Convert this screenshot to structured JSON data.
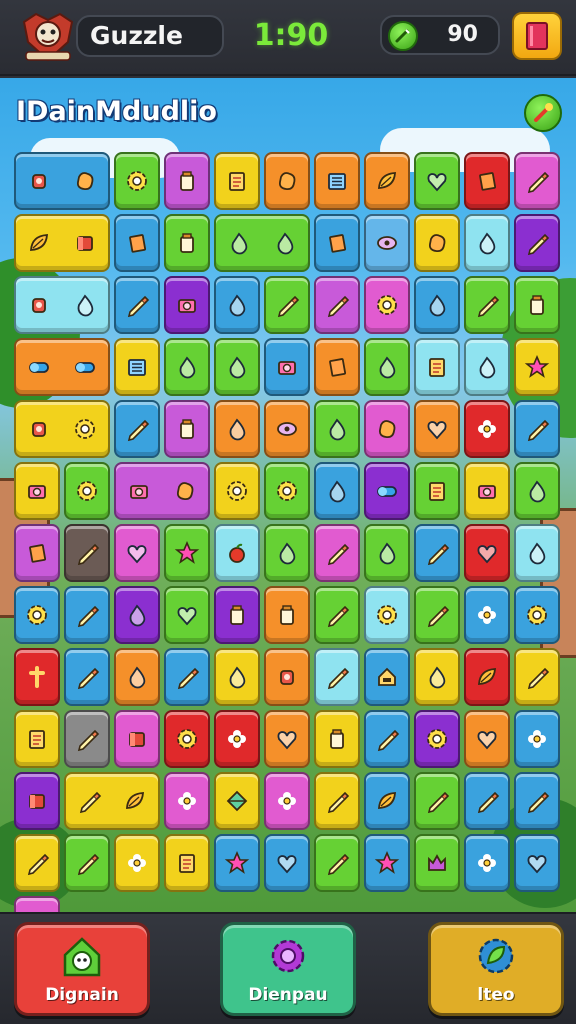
{
  "header": {
    "player_name": "Guzzle",
    "timer": "1:90",
    "coins": "90",
    "logo_icon": "mascot-crest-icon",
    "coin_icon": "green-coin-icon",
    "menu_icon": "book-icon"
  },
  "level": {
    "title": "IDainMdudlio",
    "hint_icon": "magic-hint-icon"
  },
  "board": {
    "rows": [
      [
        {
          "c": "#3aa2de",
          "g": "cup",
          "span": 2,
          "g2": "blob"
        },
        {
          "c": "#66d134",
          "g": "gear"
        },
        {
          "c": "#c85ad9",
          "g": "jar"
        },
        {
          "c": "#f2d21c",
          "g": "book"
        },
        {
          "c": "#f5902a",
          "g": "blob"
        },
        {
          "c": "#f5902a",
          "g": "list"
        },
        {
          "c": "#f5902a",
          "g": "leaf"
        },
        {
          "c": "#66d134",
          "g": "heart"
        },
        {
          "c": "#e0292b",
          "g": "tag"
        },
        {
          "c": "#e15bd0",
          "g": "pencil"
        }
      ],
      [
        {
          "c": "#f2d21c",
          "g": "leaf",
          "span": 2,
          "g2": "box"
        },
        {
          "c": "#3aa2de",
          "g": "tag"
        },
        {
          "c": "#66d134",
          "g": "jar"
        },
        {
          "c": "#66d134",
          "g": "drop",
          "span": 2,
          "g2": "drop"
        },
        {
          "c": "#3aa2de",
          "g": "tag"
        },
        {
          "c": "#64b6ea",
          "g": "eye"
        },
        {
          "c": "#f2d21c",
          "g": "blob"
        },
        {
          "c": "#8fe3f0",
          "g": "drop"
        },
        {
          "c": "#8b2fd0",
          "g": "pencil"
        }
      ],
      [
        {
          "c": "#8fe3f0",
          "g": "cup",
          "span": 2,
          "g2": "drop"
        },
        {
          "c": "#3aa2de",
          "g": "pencil"
        },
        {
          "c": "#8b2fd0",
          "g": "camera"
        },
        {
          "c": "#3aa2de",
          "g": "drop"
        },
        {
          "c": "#66d134",
          "g": "pencil"
        },
        {
          "c": "#c85ad9",
          "g": "pencil"
        },
        {
          "c": "#e15bd0",
          "g": "gear"
        },
        {
          "c": "#3aa2de",
          "g": "drop"
        },
        {
          "c": "#66d134",
          "g": "pencil"
        },
        {
          "c": "#66d134",
          "g": "jar"
        }
      ],
      [
        {
          "c": "#f5902a",
          "g": "pill",
          "span": 2,
          "g2": "pill"
        },
        {
          "c": "#f2d21c",
          "g": "list"
        },
        {
          "c": "#66d134",
          "g": "drop"
        },
        {
          "c": "#66d134",
          "g": "drop"
        },
        {
          "c": "#3aa2de",
          "g": "camera"
        },
        {
          "c": "#f5902a",
          "g": "tag"
        },
        {
          "c": "#66d134",
          "g": "drop"
        },
        {
          "c": "#8fe3f0",
          "g": "book"
        },
        {
          "c": "#8fe3f0",
          "g": "drop"
        },
        {
          "c": "#f2d21c",
          "g": "star"
        }
      ],
      [
        {
          "c": "#f2d21c",
          "g": "cup",
          "span": 2,
          "g2": "gear"
        },
        {
          "c": "#3aa2de",
          "g": "pencil"
        },
        {
          "c": "#c85ad9",
          "g": "jar"
        },
        {
          "c": "#f5902a",
          "g": "drop"
        },
        {
          "c": "#f5902a",
          "g": "eye"
        },
        {
          "c": "#66d134",
          "g": "drop"
        },
        {
          "c": "#e15bd0",
          "g": "blob"
        },
        {
          "c": "#f5902a",
          "g": "heart"
        },
        {
          "c": "#e0292b",
          "g": "flower"
        },
        {
          "c": "#3aa2de",
          "g": "pencil"
        }
      ],
      [
        {
          "c": "#f2d21c",
          "g": "camera"
        },
        {
          "c": "#66d134",
          "g": "gear"
        },
        {
          "c": "#c85ad9",
          "g": "camera",
          "span": 2,
          "g2": "blob"
        },
        {
          "c": "#f2d21c",
          "g": "gear"
        },
        {
          "c": "#66d134",
          "g": "gear"
        },
        {
          "c": "#3aa2de",
          "g": "drop"
        },
        {
          "c": "#8b2fd0",
          "g": "pill"
        },
        {
          "c": "#66d134",
          "g": "book"
        },
        {
          "c": "#f2d21c",
          "g": "camera"
        },
        {
          "c": "#66d134",
          "g": "drop"
        },
        {
          "c": "#c85ad9",
          "g": "tag"
        }
      ],
      [
        {
          "c": "#6b5b55",
          "g": "pencil"
        },
        {
          "c": "#e15bd0",
          "g": "heart"
        },
        {
          "c": "#66d134",
          "g": "star"
        },
        {
          "c": "#8fe3f0",
          "g": "apple"
        },
        {
          "c": "#66d134",
          "g": "drop"
        },
        {
          "c": "#e15bd0",
          "g": "pencil"
        },
        {
          "c": "#66d134",
          "g": "drop"
        },
        {
          "c": "#3aa2de",
          "g": "pencil"
        },
        {
          "c": "#e0292b",
          "g": "heart"
        },
        {
          "c": "#8fe3f0",
          "g": "drop"
        },
        {
          "c": "#3aa2de",
          "g": "gear"
        }
      ],
      [
        {
          "c": "#3aa2de",
          "g": "pencil"
        },
        {
          "c": "#8b2fd0",
          "g": "drop"
        },
        {
          "c": "#66d134",
          "g": "heart"
        },
        {
          "c": "#8b2fd0",
          "g": "jar"
        },
        {
          "c": "#f5902a",
          "g": "jar"
        },
        {
          "c": "#66d134",
          "g": "pencil"
        },
        {
          "c": "#8fe3f0",
          "g": "gear"
        },
        {
          "c": "#66d134",
          "g": "pencil"
        },
        {
          "c": "#3aa2de",
          "g": "flower"
        },
        {
          "c": "#3aa2de",
          "g": "gear"
        },
        {
          "c": "#e0292b",
          "g": "cross"
        }
      ],
      [
        {
          "c": "#3aa2de",
          "g": "pencil"
        },
        {
          "c": "#f5902a",
          "g": "drop"
        },
        {
          "c": "#3aa2de",
          "g": "pencil"
        },
        {
          "c": "#f2d21c",
          "g": "drop"
        },
        {
          "c": "#f5902a",
          "g": "cup"
        },
        {
          "c": "#8fe3f0",
          "g": "pencil"
        },
        {
          "c": "#3aa2de",
          "g": "house"
        },
        {
          "c": "#f2d21c",
          "g": "drop"
        },
        {
          "c": "#e0292b",
          "g": "leaf"
        },
        {
          "c": "#f2d21c",
          "g": "pencil"
        },
        {
          "c": "#f2d21c",
          "g": "book"
        }
      ],
      [
        {
          "c": "#8a8a8a",
          "g": "pencil"
        },
        {
          "c": "#e15bd0",
          "g": "box"
        },
        {
          "c": "#e0292b",
          "g": "gear"
        },
        {
          "c": "#e0292b",
          "g": "flower"
        },
        {
          "c": "#f5902a",
          "g": "heart"
        },
        {
          "c": "#f2d21c",
          "g": "jar"
        },
        {
          "c": "#3aa2de",
          "g": "pencil"
        },
        {
          "c": "#8b2fd0",
          "g": "gear"
        },
        {
          "c": "#f5902a",
          "g": "heart"
        },
        {
          "c": "#3aa2de",
          "g": "flower"
        },
        {
          "c": "#8b2fd0",
          "g": "box"
        }
      ],
      [
        {
          "c": "#f2d21c",
          "g": "pencil",
          "span": 2,
          "g2": "leaf"
        },
        {
          "c": "#e15bd0",
          "g": "flower"
        },
        {
          "c": "#f2d21c",
          "g": "diamond"
        },
        {
          "c": "#e15bd0",
          "g": "flower"
        },
        {
          "c": "#f2d21c",
          "g": "pencil"
        },
        {
          "c": "#3aa2de",
          "g": "leaf"
        },
        {
          "c": "#66d134",
          "g": "pencil"
        },
        {
          "c": "#3aa2de",
          "g": "pencil"
        },
        {
          "c": "#3aa2de",
          "g": "pencil"
        },
        {
          "c": "#f2d21c",
          "g": "pencil"
        }
      ],
      [
        {
          "c": "#66d134",
          "g": "pencil"
        },
        {
          "c": "#f2d21c",
          "g": "flower"
        },
        {
          "c": "#f2d21c",
          "g": "book"
        },
        {
          "c": "#3aa2de",
          "g": "star"
        },
        {
          "c": "#3aa2de",
          "g": "heart"
        },
        {
          "c": "#66d134",
          "g": "pencil"
        },
        {
          "c": "#3aa2de",
          "g": "star"
        },
        {
          "c": "#66d134",
          "g": "crown"
        },
        {
          "c": "#3aa2de",
          "g": "flower"
        },
        {
          "c": "#3aa2de",
          "g": "heart"
        },
        {
          "c": "#e15bd0",
          "g": "pencil"
        }
      ]
    ]
  },
  "footer": {
    "buttons": [
      {
        "label": "Dignain",
        "icon": "house-face-icon",
        "color": "#e8413a"
      },
      {
        "label": "Dienpau",
        "icon": "gear-icon",
        "color": "#3fc48c"
      },
      {
        "label": "lteo",
        "icon": "leaf-gear-icon",
        "color": "#e0ad27"
      }
    ]
  }
}
